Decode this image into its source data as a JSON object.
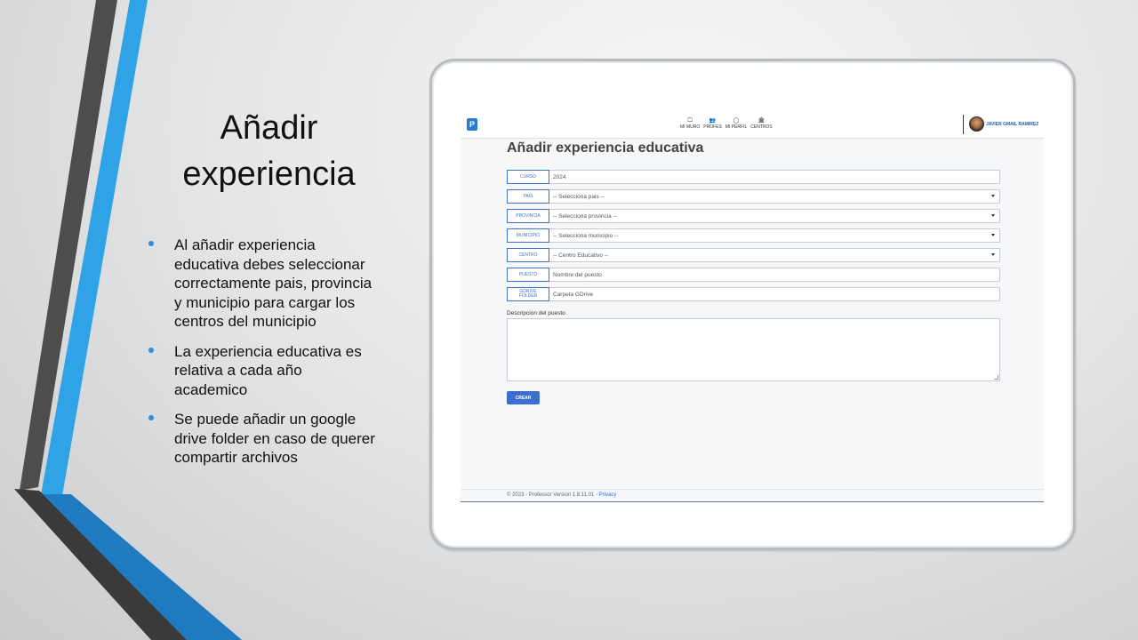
{
  "slide": {
    "title_line1": "Añadir",
    "title_line2": "experiencia",
    "bullets": [
      {
        "lines": [
          "Al añadir experiencia",
          "educativa debes seleccionar",
          "correctamente pais, provincia",
          "y municipio para cargar los",
          "centros del municipio"
        ]
      },
      {
        "lines": [
          "La experiencia educativa es",
          "relativa a cada año",
          "academico"
        ]
      },
      {
        "lines": [
          "Se puede añadir un google",
          "drive folder en caso de querer",
          "compartir archivos"
        ]
      }
    ],
    "colors": {
      "bullet": "#2b8fd6",
      "stripe_blue": "#2fa3e6",
      "stripe_dark": "#4a4a4a",
      "stripe_deep_blue": "#1f7ac0"
    }
  },
  "app": {
    "logo_letter": "P",
    "nav": [
      {
        "icon": "🖵",
        "icon_name": "monitor-icon",
        "label": "MI MURO"
      },
      {
        "icon": "👥",
        "icon_name": "users-icon",
        "label": "PROFES"
      },
      {
        "icon": "◯",
        "icon_name": "profile-icon",
        "label": "MI PERFIL"
      },
      {
        "icon": "🏛",
        "icon_name": "building-icon",
        "label": "CENTROS"
      }
    ],
    "user_name": "JAVIER GMAIL RAMIREZ",
    "form": {
      "title": "Añadir experiencia educativa",
      "fields": [
        {
          "label": "CURSO",
          "value": "2024",
          "type": "text"
        },
        {
          "label": "PAIS",
          "value": "-- Selecciona pais --",
          "type": "select"
        },
        {
          "label": "PROVINCIA",
          "value": "-- Selecciona provincia --",
          "type": "select"
        },
        {
          "label": "MUNICIPIO",
          "value": "-- Selecciona municipio --",
          "type": "select"
        },
        {
          "label": "CENTRO",
          "value": "-- Centro Educativo --",
          "type": "select"
        },
        {
          "label": "PUESTO",
          "placeholder": "Nombre del puesto",
          "type": "text"
        },
        {
          "label_line1": "GDRIVE",
          "label_line2": "FOLDER",
          "placeholder": "Carpeta GDrive",
          "type": "text"
        }
      ],
      "description_label": "Descripcion del puesto",
      "submit_label": "CREAR"
    },
    "footer_text": "© 2023 - Professor Version 1.8.11.01 - ",
    "footer_link": "Privacy",
    "colors": {
      "accent": "#3a6fd0",
      "label_border": "#3f73c7"
    }
  }
}
